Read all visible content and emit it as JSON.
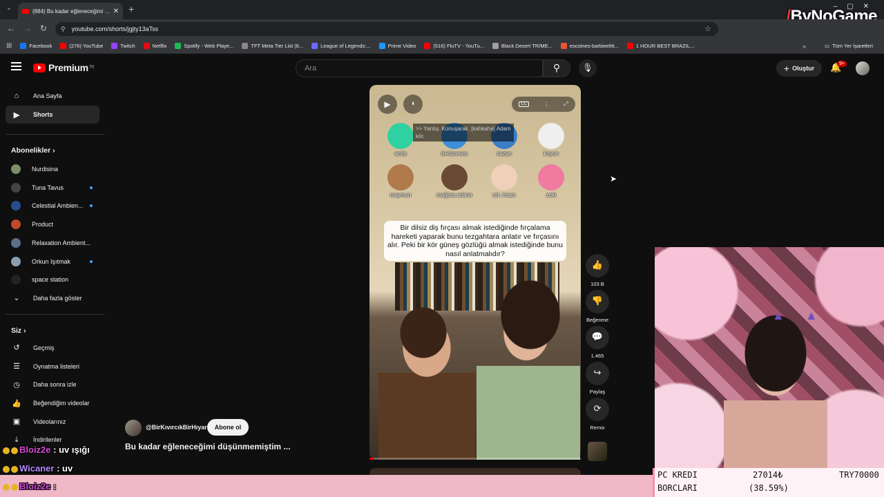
{
  "browser": {
    "tab_title": "(884) Bu kadar eğleneceğimi dü",
    "url": "youtube.com/shorts/jgjty13aTss",
    "bookmarks": [
      {
        "label": "Facebook",
        "color": "#1877f2"
      },
      {
        "label": "(276) YouTube",
        "color": "#ff0000"
      },
      {
        "label": "Twitch",
        "color": "#9146ff"
      },
      {
        "label": "Netflix",
        "color": "#e50914"
      },
      {
        "label": "Spotify - Web Playe...",
        "color": "#1db954"
      },
      {
        "label": "TFT Meta Tier List (8...",
        "color": "#888888"
      },
      {
        "label": "League of Legends:...",
        "color": "#6a6aff"
      },
      {
        "label": "Prime Video",
        "color": "#1a98ff"
      },
      {
        "label": "(516) FluTV - YouTu...",
        "color": "#ff0000"
      },
      {
        "label": "Black Desert TR/ME...",
        "color": "#a0a0a0"
      },
      {
        "label": "escoines-barbieelitt...",
        "color": "#e8552f"
      },
      {
        "label": "1 HOUR BEST BRAZIL...",
        "color": "#ff0000"
      }
    ],
    "all_bookmarks": "Tüm Yer İşaretleri",
    "overlay_logo": "ByNoGame"
  },
  "youtube": {
    "logo": "Premium",
    "logo_region": "TR",
    "search_placeholder": "Ara",
    "create_label": "Oluştur",
    "notif_count": "9+"
  },
  "sidebar": {
    "main": [
      {
        "label": "Ana Sayfa",
        "icon": "⌂"
      },
      {
        "label": "Shorts",
        "icon": "▶"
      }
    ],
    "subs_header": "Abonelikler",
    "subs": [
      {
        "label": "Nurdisina",
        "color": "#7a8f6a",
        "dot": false
      },
      {
        "label": "Tuna Tavus",
        "color": "#444444",
        "dot": true
      },
      {
        "label": "Celestial Ambien...",
        "color": "#2a4d8f",
        "dot": true
      },
      {
        "label": "Product",
        "color": "#c24a2a",
        "dot": false
      },
      {
        "label": "Relaxation Ambient...",
        "color": "#5a6f8a",
        "dot": false
      },
      {
        "label": "Orkun Işıtmak",
        "color": "#8aa0b0",
        "dot": true
      },
      {
        "label": "space station",
        "color": "#222222",
        "dot": false
      }
    ],
    "more_label": "Daha fazla göster",
    "you_header": "Siz",
    "you": [
      {
        "label": "Geçmiş",
        "icon": "↺"
      },
      {
        "label": "Oynatma listeleri",
        "icon": "☰"
      },
      {
        "label": "Daha sonra izle",
        "icon": "◷"
      },
      {
        "label": "Beğendiğim videolar",
        "icon": "👍"
      },
      {
        "label": "Videolarınız",
        "icon": "▣"
      },
      {
        "label": "İndirilenler",
        "icon": "⤓"
      }
    ]
  },
  "short": {
    "caption": ">> Yanlış. Konuşarak. [kahkaha] Adam kör.",
    "emojis": [
      {
        "label": "amip",
        "color": "#2fd1a0"
      },
      {
        "label": "denizanası",
        "color": "#3a8fd8"
      },
      {
        "label": "sazan",
        "color": "#3a7fc8"
      },
      {
        "label": "koyun",
        "color": "#efefef"
      },
      {
        "label": "maymun",
        "color": "#b07a4a"
      },
      {
        "label": "mağara adamı",
        "color": "#6a4a34"
      },
      {
        "label": "ort. insan",
        "color": "#f0d0b8"
      },
      {
        "label": "zeki",
        "color": "#f07aa0"
      }
    ],
    "quote": "Bir dilsiz diş fırçası almak istediğinde fırçalama hareketi yaparak bunu tezgahtara anlatır  ve fırçasını alır. Peki bir kör güneş gözlüğü almak istediğinde bunu nasıl anlatmalıdır?",
    "progress": 0.02,
    "channel": "@BirKıvırcıkBirHıyar",
    "subscribe_label": "Abone ol",
    "title": "Bu kadar eğleneceğimi düşünmemiştim ..."
  },
  "actions": [
    {
      "label": "103 B",
      "icon": "👍"
    },
    {
      "label": "Beğenme",
      "icon": "👎"
    },
    {
      "label": "1.465",
      "icon": "💬"
    },
    {
      "label": "Paylaş",
      "icon": "↪"
    },
    {
      "label": "Remix",
      "icon": "⟳"
    }
  ],
  "stream": {
    "debt_label_1": "PC KREDI",
    "debt_label_2": "BORCLARI",
    "debt_amount": "27014₺",
    "debt_percent": "(38.59%)",
    "debt_target": "TRY70000",
    "chat": [
      {
        "user": "Bloiz2e",
        "text": "uv ışığı"
      },
      {
        "user": "Wicaner",
        "text": "uv"
      },
      {
        "user": "Bloiz2e",
        "text": ""
      }
    ]
  }
}
